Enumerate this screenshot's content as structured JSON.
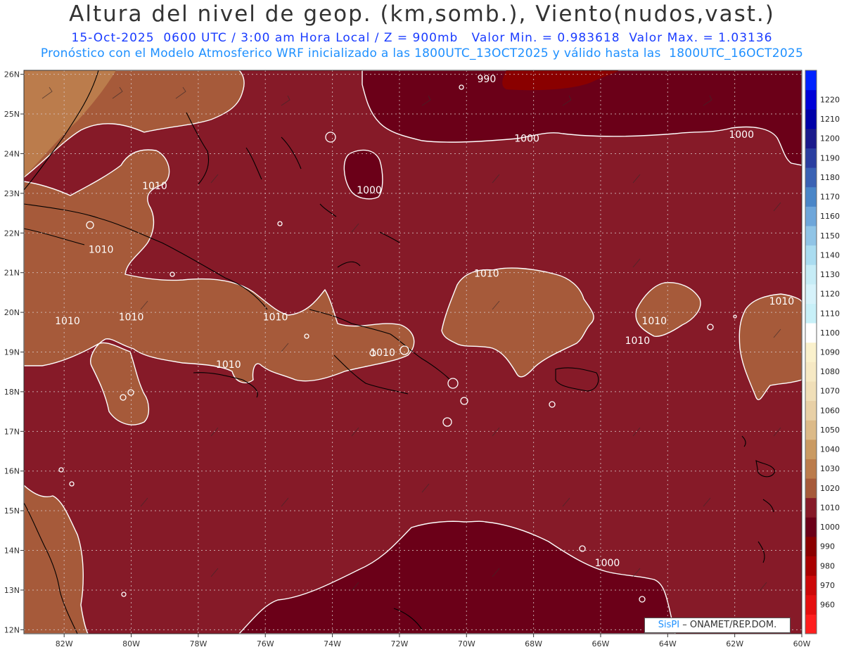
{
  "header": {
    "title": "Altura del nivel de geop. (km,somb.), Viento(nudos,vast.)",
    "line1": "15-Oct-2025  0600 UTC / 3:00 am Hora Local / Z = 900mb   Valor Min. = 0.983618  Valor Max. = 1.03136",
    "line2": "Pronóstico con el Modelo Atmosferico WRF inicializado a las 1800UTC_13OCT2025 y válido hasta las  1800UTC_16OCT2025"
  },
  "axes": {
    "lon": [
      {
        "label": "82W",
        "value": -82
      },
      {
        "label": "80W",
        "value": -80
      },
      {
        "label": "78W",
        "value": -78
      },
      {
        "label": "76W",
        "value": -76
      },
      {
        "label": "74W",
        "value": -74
      },
      {
        "label": "72W",
        "value": -72
      },
      {
        "label": "70W",
        "value": -70
      },
      {
        "label": "68W",
        "value": -68
      },
      {
        "label": "66W",
        "value": -66
      },
      {
        "label": "64W",
        "value": -64
      },
      {
        "label": "62W",
        "value": -62
      },
      {
        "label": "60W",
        "value": -60
      }
    ],
    "lat": [
      {
        "label": "26N",
        "value": 26
      },
      {
        "label": "25N",
        "value": 25
      },
      {
        "label": "24N",
        "value": 24
      },
      {
        "label": "23N",
        "value": 23
      },
      {
        "label": "22N",
        "value": 22
      },
      {
        "label": "21N",
        "value": 21
      },
      {
        "label": "20N",
        "value": 20
      },
      {
        "label": "19N",
        "value": 19
      },
      {
        "label": "18N",
        "value": 18
      },
      {
        "label": "17N",
        "value": 17
      },
      {
        "label": "16N",
        "value": 16
      },
      {
        "label": "15N",
        "value": 15
      },
      {
        "label": "14N",
        "value": 14
      },
      {
        "label": "13N",
        "value": 13
      },
      {
        "label": "12N",
        "value": 12
      }
    ],
    "lon_range": [
      -83.2,
      -60
    ],
    "lat_range": [
      11.9,
      26.1
    ]
  },
  "colorbar": [
    {
      "label": "",
      "color": "#ff1e1e"
    },
    {
      "label": "960",
      "color": "#e50f0f"
    },
    {
      "label": "970",
      "color": "#cc0808"
    },
    {
      "label": "980",
      "color": "#a80000"
    },
    {
      "label": "990",
      "color": "#8a0000"
    },
    {
      "label": "1000",
      "color": "#6b0018"
    },
    {
      "label": "1010",
      "color": "#861a28"
    },
    {
      "label": "1020",
      "color": "#a65a3a"
    },
    {
      "label": "1030",
      "color": "#bb7c4c"
    },
    {
      "label": "1040",
      "color": "#ca9a62"
    },
    {
      "label": "1050",
      "color": "#dcba88"
    },
    {
      "label": "1060",
      "color": "#e8d0a6"
    },
    {
      "label": "1070",
      "color": "#f0dfb8"
    },
    {
      "label": "1080",
      "color": "#f6e9c4"
    },
    {
      "label": "1090",
      "color": "#faf1cc"
    },
    {
      "label": "1100",
      "color": "#ffffff"
    },
    {
      "label": "1110",
      "color": "#c8f0f8"
    },
    {
      "label": "1120",
      "color": "#d6f2fa"
    },
    {
      "label": "1130",
      "color": "#c6ecf6"
    },
    {
      "label": "1140",
      "color": "#aadcf0"
    },
    {
      "label": "1150",
      "color": "#90c4e6"
    },
    {
      "label": "1160",
      "color": "#6ea6da"
    },
    {
      "label": "1170",
      "color": "#4a86c8"
    },
    {
      "label": "1180",
      "color": "#3a62b4"
    },
    {
      "label": "1190",
      "color": "#2a3ea0"
    },
    {
      "label": "1200",
      "color": "#1a1a8c"
    },
    {
      "label": "1210",
      "color": "#0000a8"
    },
    {
      "label": "1220",
      "color": "#0000d8"
    },
    {
      "label": "",
      "color": "#0022ff"
    }
  ],
  "contour_labels": [
    {
      "text": "990",
      "lon": -69.4,
      "lat": 25.8
    },
    {
      "text": "1000",
      "lon": -68.2,
      "lat": 24.3
    },
    {
      "text": "1000",
      "lon": -61.8,
      "lat": 24.4
    },
    {
      "text": "1000",
      "lon": -72.9,
      "lat": 23.0
    },
    {
      "text": "1010",
      "lon": -79.3,
      "lat": 23.1
    },
    {
      "text": "1010",
      "lon": -80.9,
      "lat": 21.5
    },
    {
      "text": "1010",
      "lon": -69.4,
      "lat": 20.9
    },
    {
      "text": "1010",
      "lon": -81.9,
      "lat": 19.7
    },
    {
      "text": "1010",
      "lon": -80.0,
      "lat": 19.8
    },
    {
      "text": "1010",
      "lon": -75.7,
      "lat": 19.8
    },
    {
      "text": "1010",
      "lon": -72.5,
      "lat": 18.9
    },
    {
      "text": "1010",
      "lon": -77.1,
      "lat": 18.6
    },
    {
      "text": "1010",
      "lon": -64.4,
      "lat": 19.7
    },
    {
      "text": "1010",
      "lon": -64.9,
      "lat": 19.2
    },
    {
      "text": "1010",
      "lon": -60.6,
      "lat": 20.2
    },
    {
      "text": "1000",
      "lon": -65.8,
      "lat": 13.6
    }
  ],
  "credit": {
    "brand": "SisPI",
    "rest": " – ONAMET/REP.DOM."
  },
  "colors": {
    "high": "#a65a3a",
    "mid": "#861a28",
    "low": "#6b0018",
    "contour": "#ffffff",
    "coast": "#000000"
  }
}
